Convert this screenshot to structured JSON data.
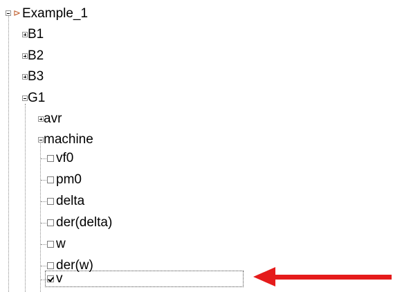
{
  "tree": {
    "root": {
      "label": "Example_1",
      "icon": "pin-icon",
      "expanded": true
    },
    "nodes": [
      {
        "label": "B1",
        "expanded": false
      },
      {
        "label": "B2",
        "expanded": false
      },
      {
        "label": "B3",
        "expanded": false
      },
      {
        "label": "G1",
        "expanded": true,
        "children": [
          {
            "label": "avr",
            "expanded": false
          },
          {
            "label": "machine",
            "expanded": true,
            "variables": [
              {
                "label": "vf0",
                "checked": false
              },
              {
                "label": "pm0",
                "checked": false
              },
              {
                "label": "delta",
                "checked": false
              },
              {
                "label": "der(delta)",
                "checked": false
              },
              {
                "label": "w",
                "checked": false
              },
              {
                "label": "der(w)",
                "checked": false
              },
              {
                "label": "v",
                "checked": true,
                "focused": true
              }
            ]
          }
        ]
      }
    ]
  },
  "annotation": {
    "arrow_color": "#e51b1b",
    "points_to": "v"
  }
}
